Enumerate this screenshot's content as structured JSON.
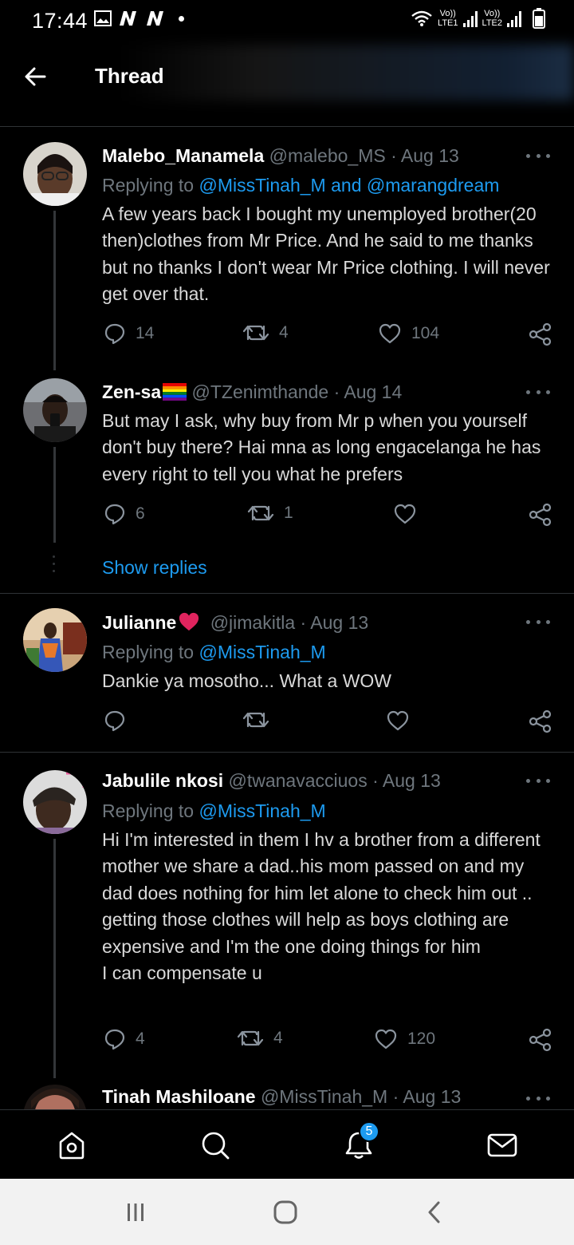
{
  "status_bar": {
    "time": "17:44",
    "sim1_label": "Vo))",
    "sim1_net": "LTE1",
    "sim2_label": "Vo))",
    "sim2_net": "LTE2"
  },
  "header": {
    "title": "Thread"
  },
  "tweets": [
    {
      "name": "Malebo_Manamela",
      "handle": "@malebo_MS",
      "date": "· Aug 13",
      "reply_prefix": "Replying to ",
      "reply_handles": "@MissTinah_M and @marangdream",
      "text": "A few years back I bought my unemployed brother(20 then)clothes from Mr Price. And he said to me thanks but no thanks I don't wear Mr Price clothing. I will never get over that.",
      "replies": "14",
      "retweets": "4",
      "likes": "104"
    },
    {
      "name": "Zen-sa",
      "handle": "@TZenimthande",
      "date": "· Aug 14",
      "text": "But may I ask, why buy from Mr p when you yourself don't buy there? Hai mna as long engacelanga he has every right to tell you what he prefers",
      "replies": "6",
      "retweets": "1",
      "likes": ""
    },
    {
      "name": "Julianne",
      "handle": "@jimakitla",
      "date": "· Aug 13",
      "reply_prefix": "Replying to ",
      "reply_handles": "@MissTinah_M",
      "text": "Dankie ya mosotho... What a WOW",
      "replies": "",
      "retweets": "",
      "likes": ""
    },
    {
      "name": "Jabulile nkosi",
      "handle": "@twanavacciuos",
      "date": "· Aug 13",
      "reply_prefix": "Replying to ",
      "reply_handles": "@MissTinah_M",
      "text": "Hi I'm interested in them I hv a brother from a different mother we share a dad..his mom passed on and my dad does nothing for him let alone to check him out .. getting those clothes will help as boys clothing are expensive and I'm the one doing things for him",
      "text2": "I can compensate u",
      "replies": "4",
      "retweets": "4",
      "likes": "120"
    },
    {
      "name": "Tinah Mashiloane",
      "handle": "@MissTinah_M",
      "date": "· Aug 13"
    }
  ],
  "show_replies": "Show replies",
  "bottom_nav": {
    "notifications_badge": "5"
  },
  "icons": [
    "back-arrow-icon",
    "more-icon",
    "reply-icon",
    "retweet-icon",
    "like-icon",
    "share-icon",
    "home-icon",
    "search-icon",
    "bell-icon",
    "mail-icon"
  ],
  "colors": {
    "accent": "#1d9bf0",
    "background": "#000000",
    "muted": "#6e767d",
    "heart": "#e0245e"
  }
}
